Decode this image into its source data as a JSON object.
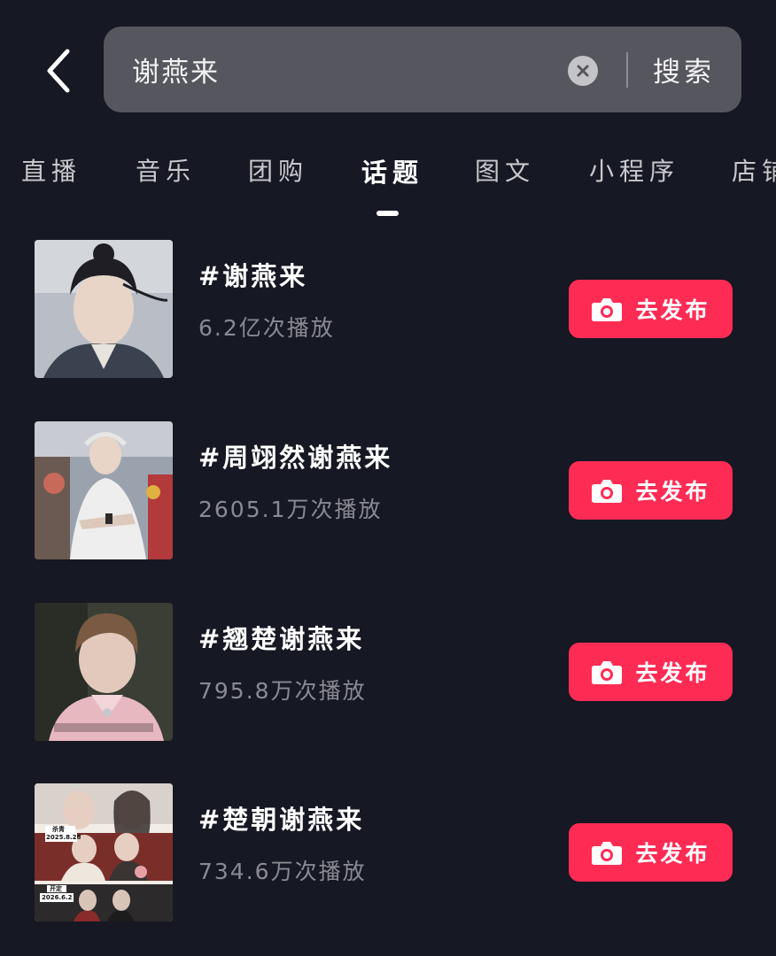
{
  "search": {
    "query": "谢燕来",
    "search_label": "搜索"
  },
  "tabs": [
    {
      "label": "直播"
    },
    {
      "label": "音乐"
    },
    {
      "label": "团购"
    },
    {
      "label": "话题",
      "active": true
    },
    {
      "label": "图文"
    },
    {
      "label": "小程序"
    },
    {
      "label": "店铺"
    }
  ],
  "topics": [
    {
      "title": "#谢燕来",
      "plays": "6.2亿次播放",
      "button": "去发布"
    },
    {
      "title": "#周翊然谢燕来",
      "plays": "2605.1万次播放",
      "button": "去发布"
    },
    {
      "title": "#翘楚谢燕来",
      "plays": "795.8万次播放",
      "button": "去发布"
    },
    {
      "title": "#楚朝谢燕来",
      "plays": "734.6万次播放",
      "button": "去发布",
      "thumb_labels": [
        "杀青",
        "2025.8.28",
        "开定",
        "2026.6.2"
      ]
    }
  ],
  "colors": {
    "background": "#161823",
    "search_bg": "#55565e",
    "accent": "#fe2c55",
    "secondary_text": "#8a8b92"
  },
  "icons": {
    "back": "chevron-left-icon",
    "clear": "clear-circle-icon",
    "publish": "camera-icon"
  }
}
